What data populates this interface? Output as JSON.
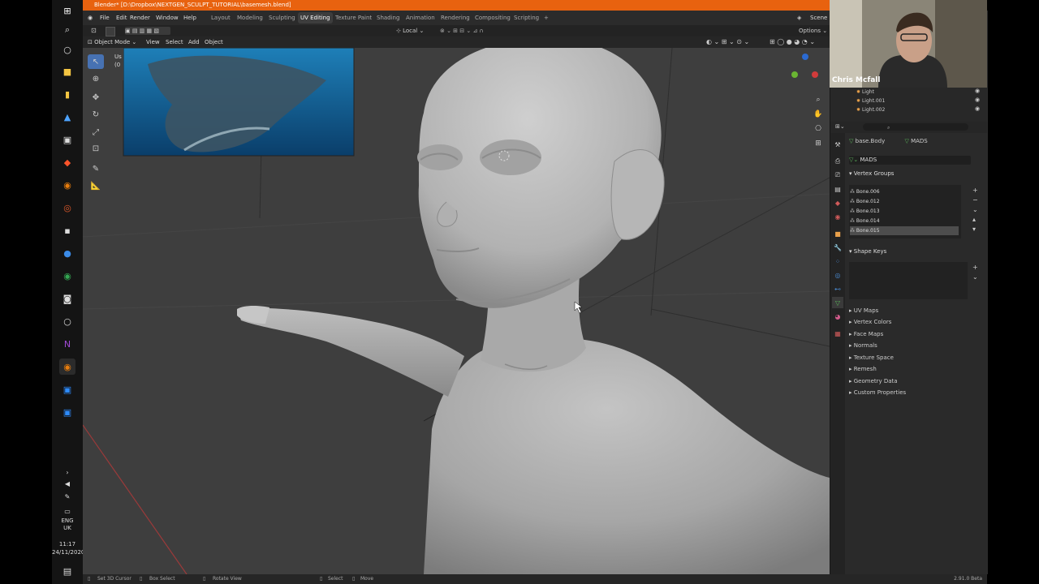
{
  "window": {
    "title": "Blender* [D:\\Dropbox\\NEXTGEN_SCULPT_TUTORIAL\\basemesh.blend]"
  },
  "menu": {
    "file": "File",
    "edit": "Edit",
    "render": "Render",
    "window": "Window",
    "help": "Help"
  },
  "workspaces": [
    "Layout",
    "Modeling",
    "Sculpting",
    "UV Editing",
    "Texture Paint",
    "Shading",
    "Animation",
    "Rendering",
    "Compositing",
    "Scripting"
  ],
  "active_workspace": "UV Editing",
  "scene_label": "Scene",
  "toolrow": {
    "pivot": "Local",
    "options": "Options"
  },
  "header": {
    "mode": "Object Mode",
    "view": "View",
    "select": "Select",
    "add": "Add",
    "object": "Object"
  },
  "viewport": {
    "overlay_text_1": "Us",
    "overlay_text_2": "(0"
  },
  "webcam": {
    "name": "Chris Mcfall"
  },
  "outliner": {
    "items": [
      "Light",
      "Light.001",
      "Light.002"
    ]
  },
  "properties": {
    "breadcrumb_object": "base.Body",
    "breadcrumb_data": "MADS",
    "mesh_name": "MADS",
    "vertex_groups_title": "Vertex Groups",
    "vertex_groups": [
      "Bone.006",
      "Bone.012",
      "Bone.013",
      "Bone.014",
      "Bone.015"
    ],
    "shape_keys_title": "Shape Keys",
    "panels": [
      "UV Maps",
      "Vertex Colors",
      "Face Maps",
      "Normals",
      "Texture Space",
      "Remesh",
      "Geometry Data",
      "Custom Properties"
    ]
  },
  "statusbar": {
    "set_cursor": "Set 3D Cursor",
    "box_select": "Box Select",
    "rotate_view": "Rotate View",
    "select": "Select",
    "move": "Move",
    "version": "2.91.0 Beta"
  },
  "taskbar": {
    "lang_line1": "ENG",
    "lang_line2": "UK",
    "time": "11:17",
    "date": "24/11/2020"
  },
  "colors": {
    "title_orange": "#e8620f",
    "viewport_bg": "#3e3e3e",
    "panel_bg": "#2a2a2a",
    "active_blue": "#4772b3"
  }
}
